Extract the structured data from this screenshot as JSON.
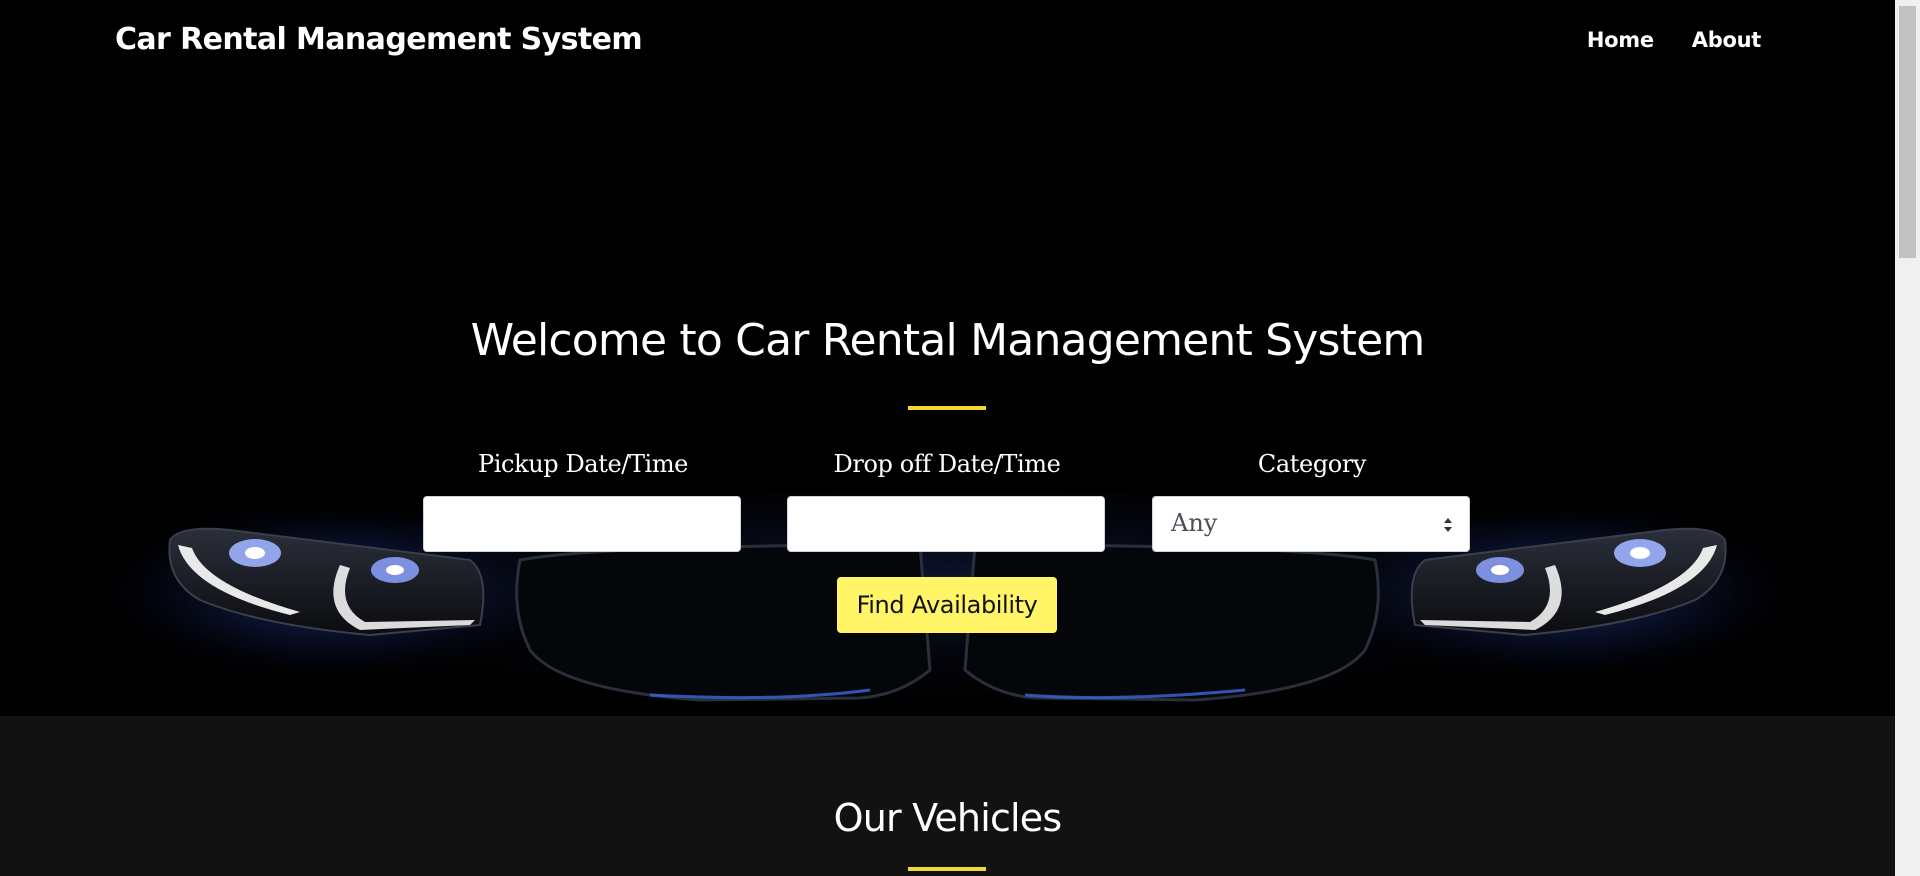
{
  "navbar": {
    "brand": "Car Rental Management System",
    "links": [
      {
        "label": "Home"
      },
      {
        "label": "About"
      }
    ]
  },
  "hero": {
    "title": "Welcome to Car Rental Management System",
    "accent_color": "#f2d93a"
  },
  "search_form": {
    "pickup": {
      "label": "Pickup Date/Time",
      "value": ""
    },
    "dropoff": {
      "label": "Drop off Date/Time",
      "value": ""
    },
    "category": {
      "label": "Category",
      "selected": "Any"
    },
    "submit_label": "Find Availability",
    "button_color": "#fff566"
  },
  "vehicles_section": {
    "title": "Our Vehicles"
  }
}
